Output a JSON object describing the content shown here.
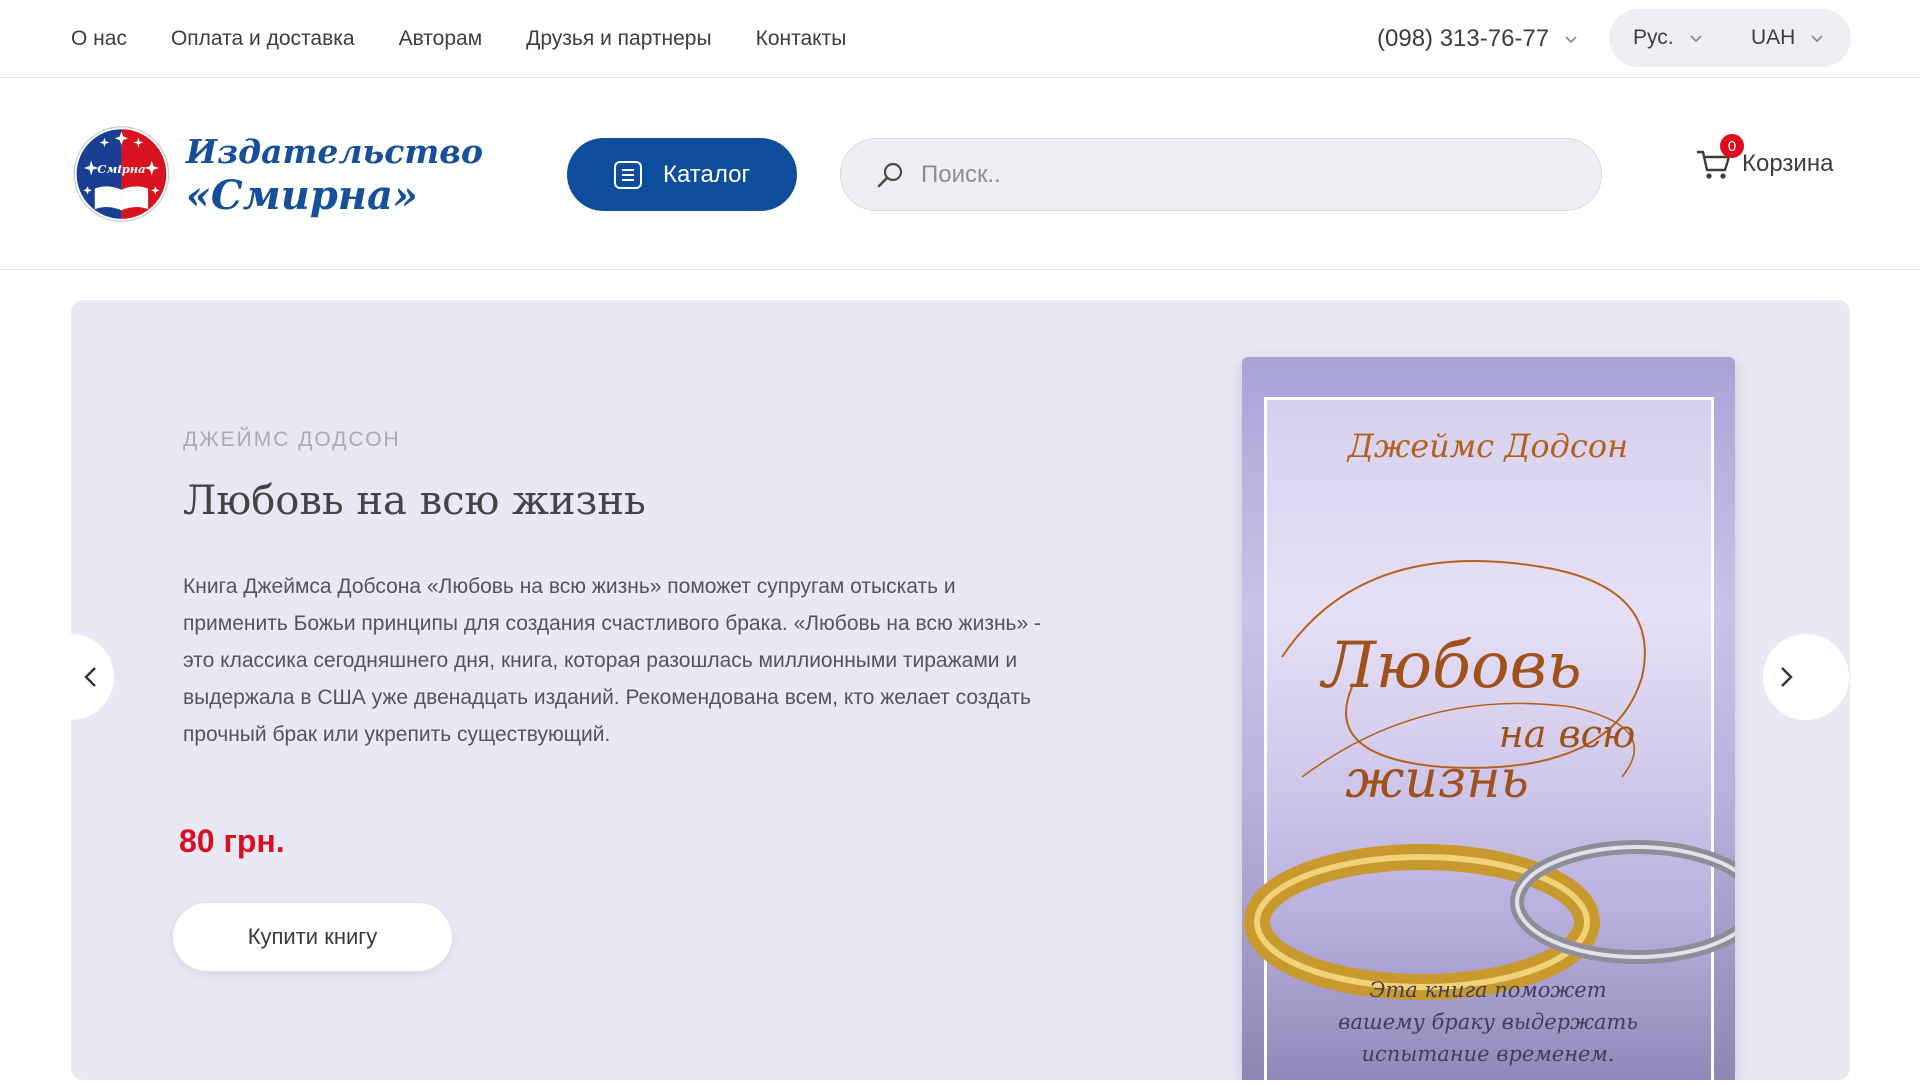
{
  "topbar": {
    "nav": [
      "О нас",
      "Оплата и доставка",
      "Авторам",
      "Друзья и партнеры",
      "Контакты"
    ],
    "phone": "(098) 313-76-77",
    "language": "Рус.",
    "currency": "UAH"
  },
  "header": {
    "logo": {
      "emblem_text": "Смірна",
      "line1": "Издательство",
      "line2": "«Смирна»"
    },
    "catalog_label": "Каталог",
    "search_placeholder": "Поиск..",
    "cart_label": "Корзина",
    "cart_count": "0"
  },
  "hero": {
    "author": "Джеймс Додсон",
    "title": "Любовь на всю жизнь",
    "description": "Книга Джеймса Добсона «Любовь на всю жизнь» поможет супругам отыскать и применить Божьи принципы для создания счастливого брака. «Любовь на всю жизнь» - это классика сегодняшнего дня, книга, которая разошлась миллионными тиражами и выдержала в США уже двенадцать изданий. Рекомендована всем, кто желает создать прочный брак или укрепить существующий.",
    "price": "80 грн.",
    "buy_label": "Купити книгу",
    "cover": {
      "author_line": "Джеймс Додсон",
      "title_line1": "Любовь",
      "title_line2": "на всю",
      "title_line3": "жизнь",
      "tagline1": "Эта книга поможет",
      "tagline2": "вашему браку выдержать",
      "tagline3": "испытание временем."
    }
  },
  "colors": {
    "brand_blue": "#0d4d9c",
    "price_red": "#d90f1f",
    "hero_bg": "#e9e8f5"
  }
}
